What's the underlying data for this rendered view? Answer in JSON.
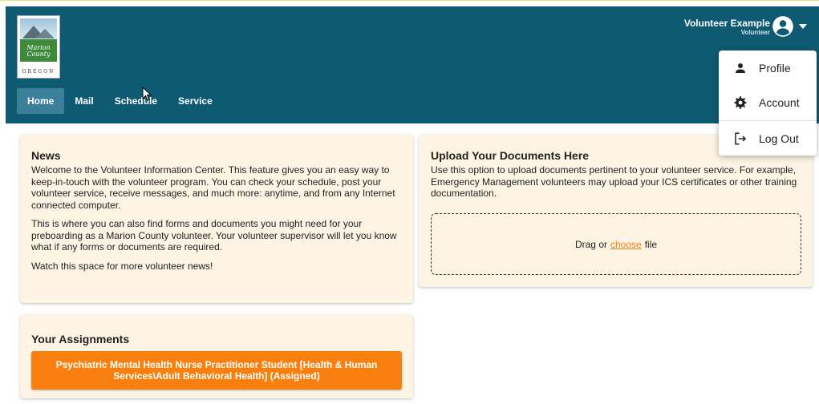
{
  "logo": {
    "county_name": "Marion County",
    "state": "OREGON"
  },
  "nav": {
    "items": [
      {
        "label": "Home",
        "active": true
      },
      {
        "label": "Mail",
        "active": false
      },
      {
        "label": "Schedule",
        "active": false
      },
      {
        "label": "Service",
        "active": false
      }
    ]
  },
  "user": {
    "name": "Volunteer Example",
    "role": "Volunteer",
    "icon": "account-circle-icon"
  },
  "user_menu": {
    "items": [
      {
        "label": "Profile",
        "icon": "person-icon"
      },
      {
        "label": "Account",
        "icon": "gear-icon"
      },
      {
        "label": "Log Out",
        "icon": "logout-icon"
      }
    ]
  },
  "news": {
    "title": "News",
    "paragraphs": [
      "Welcome to the Volunteer Information Center. This feature gives you an easy way to keep-in-touch with the volunteer program. You can check your schedule, post your volunteer service, receive messages, and much more: anytime, and from any Internet connected computer.",
      "This is where you can also find forms and documents you might need for your preboarding as a Marion County volunteer. Your volunteer supervisor will let you know what if any forms or documents are required.",
      "Watch this space for more volunteer news!"
    ]
  },
  "upload": {
    "title": "Upload Your Documents Here",
    "description": "Use this option to upload documents pertinent to your volunteer service. For example, Emergency Management volunteers may upload your ICS certificates or other training documentation.",
    "drop_prefix": "Drag or",
    "drop_link": "choose",
    "drop_suffix": "file"
  },
  "assignments": {
    "title": "Your Assignments",
    "items": [
      {
        "label": "Psychiatric Mental Health Nurse Practitioner Student [Health & Human Services\\Adult Behavioral Health] (Assigned)"
      }
    ]
  },
  "colors": {
    "header": "#0e5a73",
    "nav_active": "#3c7f9a",
    "card_bg": "#fdf4e4",
    "accent": "#f9800f"
  }
}
